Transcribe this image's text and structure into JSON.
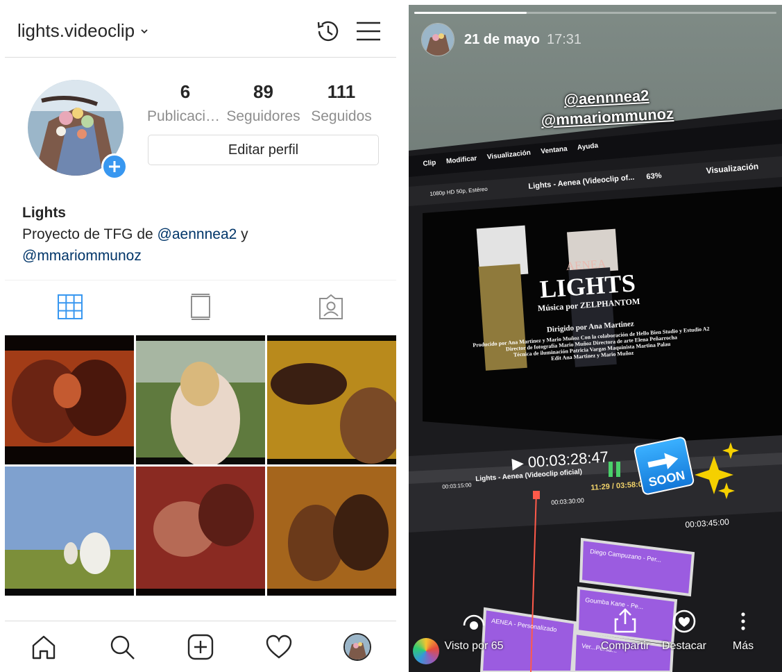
{
  "profile": {
    "username": "lights.videoclip",
    "stats": [
      {
        "value": "6",
        "label": "Publicaciones"
      },
      {
        "value": "89",
        "label": "Seguidores"
      },
      {
        "value": "111",
        "label": "Seguidos"
      }
    ],
    "edit_profile_label": "Editar perfil",
    "bio": {
      "name": "Lights",
      "text_prefix": "Proyecto de TFG de ",
      "mention1": "@aennnea2",
      "connector": " y ",
      "mention2": "@mmariommunoz"
    },
    "tabs": [
      "grid",
      "feed",
      "tagged"
    ],
    "posts": [
      {
        "desc": "couple kissing, warm orange tone"
      },
      {
        "desc": "woman in field with flower"
      },
      {
        "desc": "couple with blindfold, yellow tone"
      },
      {
        "desc": "girl running in meadow"
      },
      {
        "desc": "couple in bed, red tone"
      },
      {
        "desc": "couple close embrace, amber tone"
      }
    ],
    "bottom_nav": [
      "home",
      "search",
      "new-post",
      "activity",
      "profile"
    ]
  },
  "story": {
    "date": "21 de mayo",
    "time": "17:31",
    "mentions": [
      "@aennnea2",
      "@mmariommunoz"
    ],
    "progress": 0.31,
    "screen": {
      "menu": [
        "Clip",
        "Modificar",
        "Visualización",
        "Ventana",
        "Ayuda"
      ],
      "format": "1080p HD 50p, Estéreo",
      "project": "Lights - Aenea (Videoclip of...",
      "zoom": "63%",
      "view": "Visualización",
      "credits": {
        "artist": "AENEA",
        "title": "LIGHTS",
        "music": "Música por ZELPHANTOM",
        "director": "Dirigido por Ana Martinez",
        "line1": "Producido por Ana Martinez y Mario Muñoz  Con la colaboración de Hello Bien Studio y Estudio A2",
        "line2": "Director de fotografía Mario Muñoz  Directora de arte Elena Peñarrocha",
        "line3": "Técnica de iluminación Patricia Vargas  Maquinista Martina Palau",
        "line4": "Edit Ana Martinez y Mario Muñoz"
      },
      "timecode": "00:03:28:47",
      "timeline_title": "Lights - Aenea (Videoclip oficial)",
      "timeline_pos": "11:29 / 03:58:02",
      "ticks": [
        "00:03:15:00",
        "00:03:30:00",
        "00:03:45:00"
      ],
      "clips": [
        "Diego Campuzano - Per...",
        "Goumba Kane - Pe...",
        "AENEA - Personalizado",
        "Ver...Persa..."
      ]
    },
    "sticker": "SOON",
    "footer": {
      "seen": "Visto por 65",
      "share": "Compartir",
      "highlight": "Destacar",
      "more": "Más"
    }
  }
}
